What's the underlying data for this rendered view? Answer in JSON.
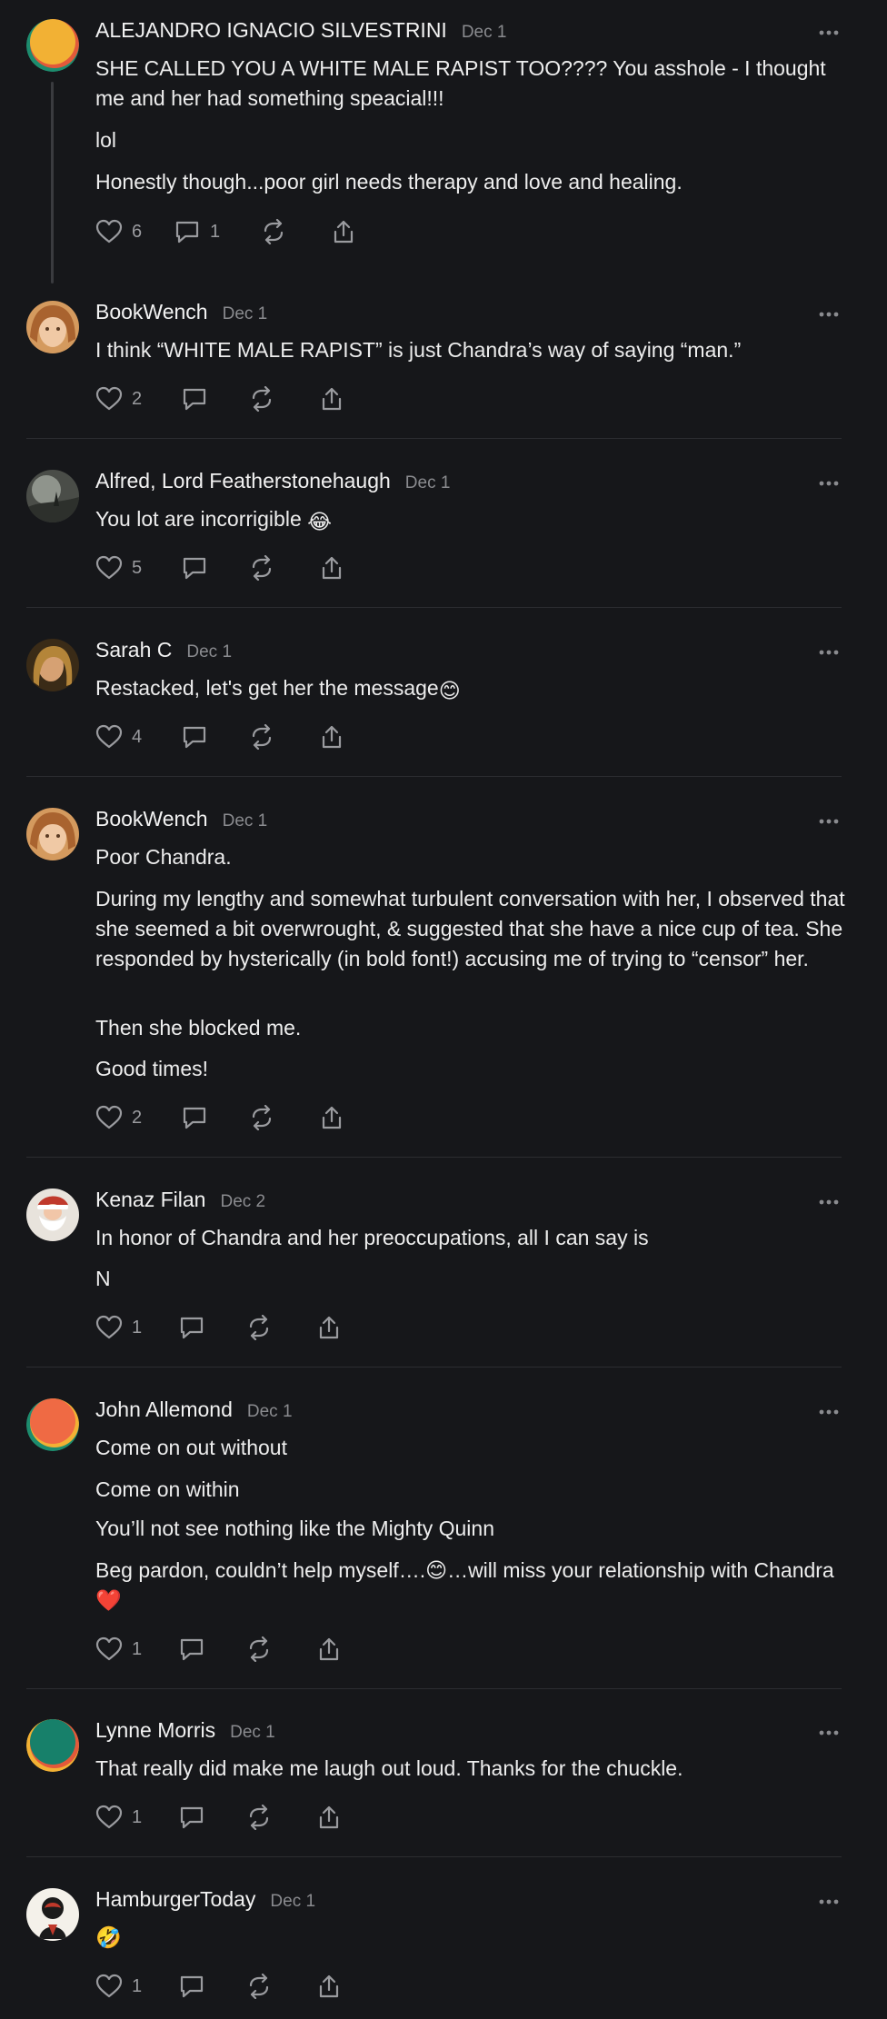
{
  "comments": [
    {
      "author": "ALEJANDRO IGNACIO SILVESTRINI",
      "date": "Dec 1",
      "paragraphs": [
        "SHE CALLED YOU A WHITE MALE RAPIST TOO???? You asshole - I thought me and her had something speacial!!!",
        "lol",
        "Honestly though...poor girl needs therapy and love and healing."
      ],
      "likes": "6",
      "replies": "1"
    },
    {
      "author": "BookWench",
      "date": "Dec 1",
      "paragraphs": [
        "I think “WHITE MALE RAPIST” is just Chandra’s way of saying “man.”"
      ],
      "likes": "2"
    },
    {
      "author": "Alfred, Lord Featherstonehaugh",
      "date": "Dec 1",
      "paragraphs": [
        "You lot are incorrigible"
      ],
      "emoji": "😂",
      "likes": "5"
    },
    {
      "author": "Sarah C",
      "date": "Dec 1",
      "paragraphs": [
        "Restacked, let's get her the message"
      ],
      "emoji": "😊",
      "likes": "4"
    },
    {
      "author": "BookWench",
      "date": "Dec 1",
      "paragraphs": [
        "Poor Chandra.",
        "During my lengthy and somewhat turbulent conversation with her, I observed that she seemed a bit overwrought, & suggested that she have a nice cup of tea. She responded by hysterically (in bold font!) accusing me of trying to “censor” her.",
        "Then she blocked me.",
        "Good times!"
      ],
      "likes": "2"
    },
    {
      "author": "Kenaz Filan",
      "date": "Dec 2",
      "paragraphs": [
        "In honor of Chandra and her preoccupations, all I can say is",
        "N"
      ],
      "likes": "1"
    },
    {
      "author": "John Allemond",
      "date": "Dec 1",
      "paragraphs": [
        "Come on out without",
        "Come on within",
        "You’ll not see nothing like the Mighty Quinn",
        "Beg pardon, couldn’t help myself….😊…will miss your relationship with Chandra❤️"
      ],
      "likes": "1"
    },
    {
      "author": "Lynne Morris",
      "date": "Dec 1",
      "paragraphs": [
        "That really did make me laugh out loud. Thanks for the chuckle."
      ],
      "likes": "1"
    },
    {
      "author": "HamburgerToday",
      "date": "Dec 1",
      "paragraphs": [
        "🤣"
      ],
      "likes": "1"
    }
  ],
  "colors": {
    "background": "#16171a",
    "text": "#ededed",
    "muted": "#8a8b8f",
    "divider": "#2c2d31"
  }
}
